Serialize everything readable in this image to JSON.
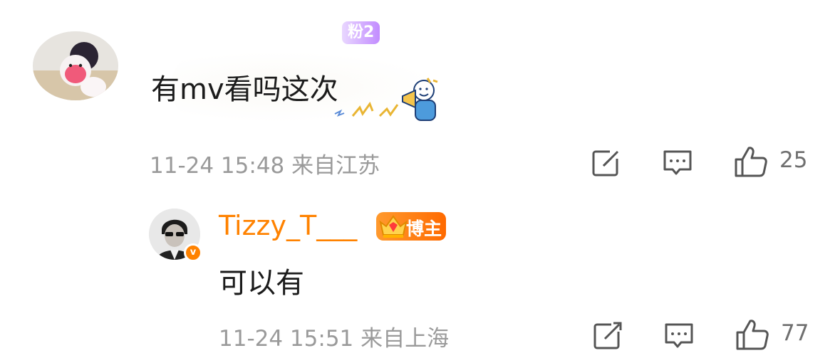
{
  "comment": {
    "username_partial": "",
    "fan_badge": "粉2",
    "text": "有mv看吗这次",
    "meta": "11-24 15:48 来自江苏",
    "likes": "25"
  },
  "reply": {
    "username": "Tizzy_T___",
    "host_badge": "博主",
    "verified_mark": "v",
    "text": "可以有",
    "meta": "11-24 15:51 来自上海",
    "likes": "77"
  },
  "icons": {
    "share": "share-icon",
    "comment": "comment-icon",
    "like": "thumbs-up-icon"
  },
  "colors": {
    "accent": "#ff8200",
    "meta": "#9a9a9a",
    "text": "#1b1b1b"
  }
}
